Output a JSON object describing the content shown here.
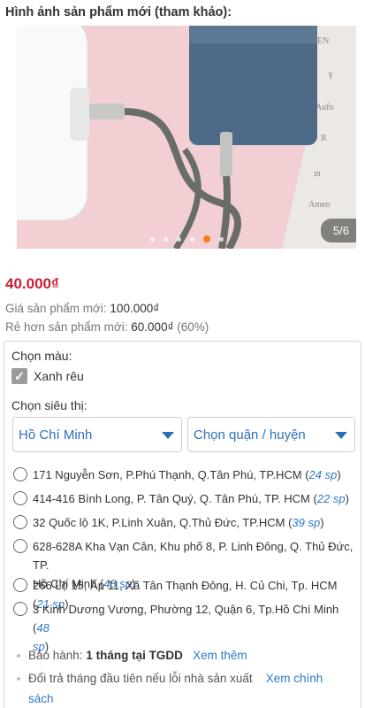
{
  "section_title": "Hình ảnh sản phẩm mới (tham khảo):",
  "gallery": {
    "counter": "5/6",
    "dot_count": 6,
    "active_index": 4
  },
  "price": "40.000₫",
  "new_price": {
    "label": "Giá sản phẩm mới:",
    "value": "100.000₫"
  },
  "savings": {
    "label": "Rẻ hơn sản phẩm mới:",
    "value": "60.000₫",
    "percent": "(60%)"
  },
  "color": {
    "label": "Chọn màu:",
    "option": "Xanh rêu",
    "checked": true
  },
  "store_picker": {
    "label": "Chọn siêu thị:",
    "city": "Hồ Chí Minh",
    "district_placeholder": "Chọn quận / huyện"
  },
  "stores": [
    {
      "line1": "171 Nguyễn Sơn, P.Phú Thạnh, Q.Tân Phú, TP.HCM",
      "stock": "24 sp",
      "line2": ""
    },
    {
      "line1": "414-416 Bình Long, P. Tân Quý, Q. Tân Phú, TP. HCM",
      "stock": "22 sp",
      "line2": ""
    },
    {
      "line1": "32 Quốc lộ 1K, P.Linh Xuân, Q.Thủ Đức, TP.HCM",
      "stock": "39 sp",
      "line2": ""
    },
    {
      "line1": "628-628A Kha Vạn Cân, Khu phố 8, P. Linh Đông, Q. Thủ Đức, TP.",
      "line2": "Hồ Chí Minh",
      "stock": "48 sp"
    },
    {
      "line1": "266 Lộ 15, Ấp 11, Xã Tân Thạnh Đông, H. Củ Chi, Tp. HCM",
      "stock": "21 sp",
      "line2": ""
    },
    {
      "line1": "3 Kinh Dương Vương, Phường 12, Quận 6, Tp.Hồ Chí Minh",
      "stock_part1": "48",
      "stock_part2": "sp",
      "line2": ""
    }
  ],
  "warranty": {
    "label": "Bảo hành:",
    "value": "1 tháng tại TGDD",
    "link": "Xem thêm"
  },
  "return_policy": {
    "text": "Đổi trả tháng đầu tiên nếu lỗi nhà sản xuất",
    "link_part1": "Xem chính",
    "link_part2": "sách"
  },
  "colors": {
    "price_red": "#c71f2f",
    "link_blue": "#2f78c4",
    "accent_orange": "#ff7a1a"
  }
}
